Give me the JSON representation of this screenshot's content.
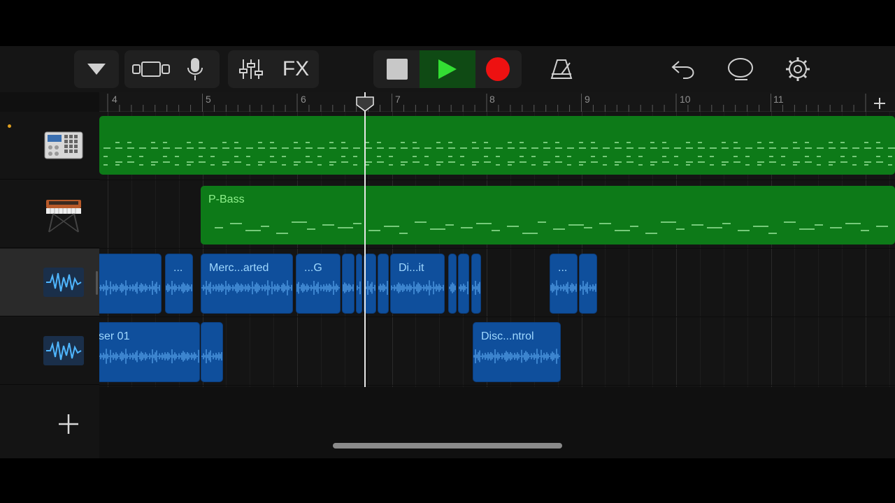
{
  "toolbar": {
    "fx_label": "FX"
  },
  "ruler": {
    "bars": [
      "4",
      "5",
      "6",
      "7",
      "8",
      "9",
      "10",
      "11"
    ]
  },
  "tracks": [
    {
      "instrument": "drum-machine-icon",
      "regions": []
    },
    {
      "instrument": "synth-keyboard-icon",
      "regions": [
        {
          "label": "P-Bass"
        }
      ]
    },
    {
      "instrument": "audio-waveform-icon",
      "selected": true,
      "regions": [
        {
          "label": "..."
        },
        {
          "label": "Merc...arted"
        },
        {
          "label": "...G"
        },
        {
          "label": "Di...it"
        },
        {
          "label": "..."
        }
      ]
    },
    {
      "instrument": "audio-waveform-icon",
      "regions": [
        {
          "label": "ser 01"
        },
        {
          "label": "Disc...ntrol"
        }
      ]
    }
  ],
  "colors": {
    "midi_region": "#0d7a18",
    "audio_region": "#0f4f9c",
    "play": "#33dd33",
    "record": "#ee1111",
    "playhead": "#e8e8e8"
  }
}
